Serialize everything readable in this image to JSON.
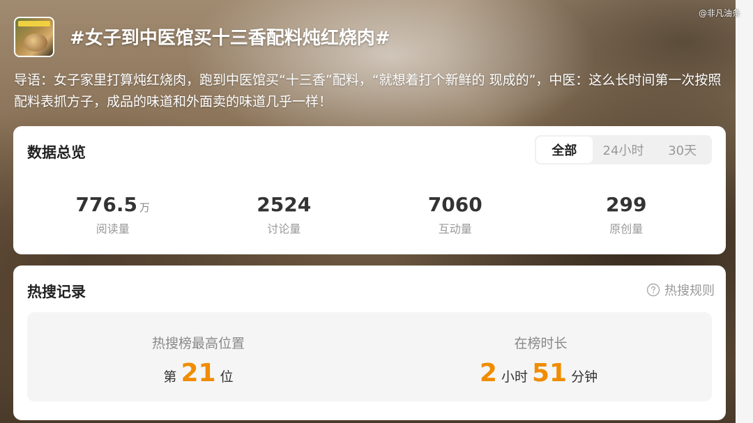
{
  "watermark": "@非凡油条",
  "topic": {
    "title": "#女子到中医馆买十三香配料炖红烧肉#",
    "intro": "导语：女子家里打算炖红烧肉，跑到中医馆买“十三香”配料，“就想着打个新鲜的 现成的”，中医：这么长时间第一次按照配料表抓方子，成品的味道和外面卖的味道几乎一样！"
  },
  "overview": {
    "title": "数据总览",
    "tabs": [
      {
        "label": "全部",
        "active": true
      },
      {
        "label": "24小时",
        "active": false
      },
      {
        "label": "30天",
        "active": false
      }
    ],
    "stats": [
      {
        "value": "776.5",
        "unit": "万",
        "label": "阅读量"
      },
      {
        "value": "2524",
        "unit": "",
        "label": "讨论量"
      },
      {
        "value": "7060",
        "unit": "",
        "label": "互动量"
      },
      {
        "value": "299",
        "unit": "",
        "label": "原创量"
      }
    ]
  },
  "hot_search": {
    "title": "热搜记录",
    "rules_label": "热搜规则",
    "rules_icon": "question-circle-icon",
    "highest": {
      "label": "热搜榜最高位置",
      "prefix": "第",
      "rank": "21",
      "suffix": "位"
    },
    "duration": {
      "label": "在榜时长",
      "hours": "2",
      "hours_unit": "小时",
      "minutes": "51",
      "minutes_unit": "分钟"
    }
  },
  "colors": {
    "accent": "#f08c00",
    "card": "#ffffff",
    "muted": "#999999"
  }
}
